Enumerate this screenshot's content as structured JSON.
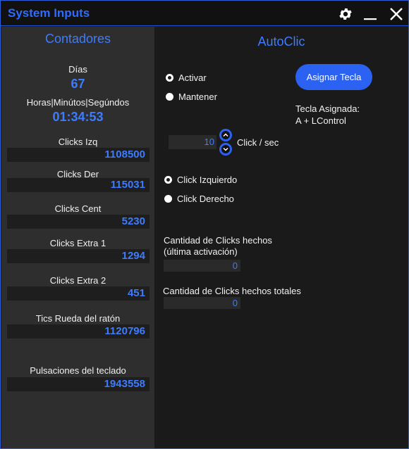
{
  "window": {
    "title": "System Inputs"
  },
  "icons": {
    "settings": "gear-icon",
    "minimize": "minimize-icon",
    "close": "close-icon"
  },
  "colors": {
    "accent": "#3d7cff",
    "button": "#2c62f2",
    "left_panel": "#2e2e2e",
    "background": "#1a1a1a"
  },
  "counters": {
    "title": "Contadores",
    "days_label": "Días",
    "days_value": "67",
    "time_label": "Horas|Minútos|Segúndos",
    "time_value": "01:34:53",
    "items": [
      {
        "label": "Clicks Izq",
        "value": "1108500"
      },
      {
        "label": "Clicks Der",
        "value": "115031"
      },
      {
        "label": "Clicks Cent",
        "value": "5230"
      },
      {
        "label": "Clicks Extra 1",
        "value": "1294"
      },
      {
        "label": "Clicks Extra 2",
        "value": "451"
      },
      {
        "label": "Tics Rueda del ratón",
        "value": "1120796"
      },
      {
        "label": "Pulsaciones del teclado",
        "value": "1943558"
      }
    ]
  },
  "autoclic": {
    "title": "AutoClic",
    "mode_options": {
      "activar": "Activar",
      "mantener": "Mantener"
    },
    "assign_button": "Asignar Tecla",
    "assigned_label": "Tecla Asignada:",
    "assigned_key": "A + LControl",
    "rate_value": "10",
    "rate_unit": "Click / sec",
    "button_options": {
      "left": "Click Izquierdo",
      "right": "Click Derecho"
    },
    "last_count_label_1": "Cantidad de Clicks hechos",
    "last_count_label_2": "(última activación)",
    "last_count_value": "0",
    "total_count_label": "Cantidad de Clicks hechos totales",
    "total_count_value": "0"
  }
}
